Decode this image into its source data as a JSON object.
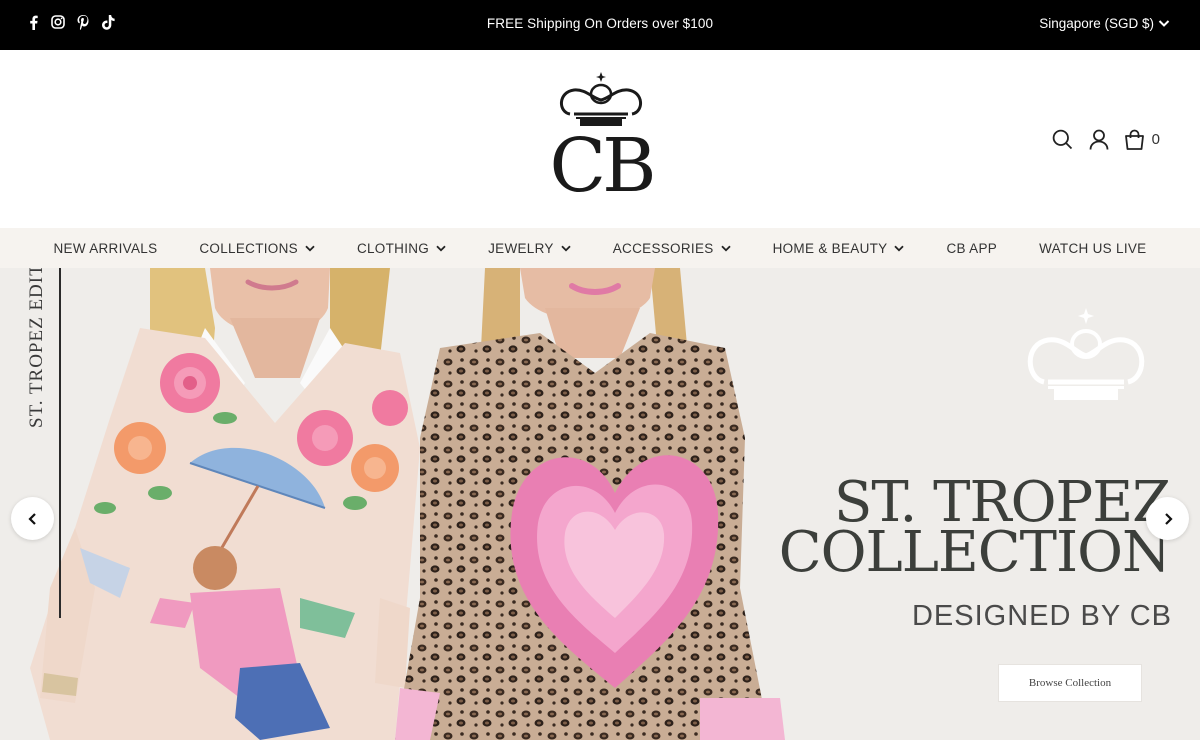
{
  "topbar": {
    "social": [
      "facebook-icon",
      "instagram-icon",
      "pinterest-icon",
      "tiktok-icon"
    ],
    "announcement": "FREE Shipping On Orders over $100",
    "currency": "Singapore (SGD $)"
  },
  "header": {
    "logo_text": "CB",
    "cart_count": "0"
  },
  "nav": {
    "items": [
      {
        "label": "NEW ARRIVALS",
        "dropdown": false
      },
      {
        "label": "COLLECTIONS",
        "dropdown": true
      },
      {
        "label": "CLOTHING",
        "dropdown": true
      },
      {
        "label": "JEWELRY",
        "dropdown": true
      },
      {
        "label": "ACCESSORIES",
        "dropdown": true
      },
      {
        "label": "HOME & BEAUTY",
        "dropdown": true
      },
      {
        "label": "CB APP",
        "dropdown": false
      },
      {
        "label": "WATCH US LIVE",
        "dropdown": false
      }
    ]
  },
  "hero": {
    "edit_label": "ST. TROPEZ EDIT",
    "title_line1": "ST. TROPEZ",
    "title_line2": "COLLECTION",
    "subtitle": "DESIGNED BY CB",
    "button_label": "Browse Collection"
  },
  "colors": {
    "topbar_bg": "#000000",
    "nav_bg": "#f6f3ef",
    "hero_bg": "#efedea",
    "pink": "#e97fb3"
  }
}
